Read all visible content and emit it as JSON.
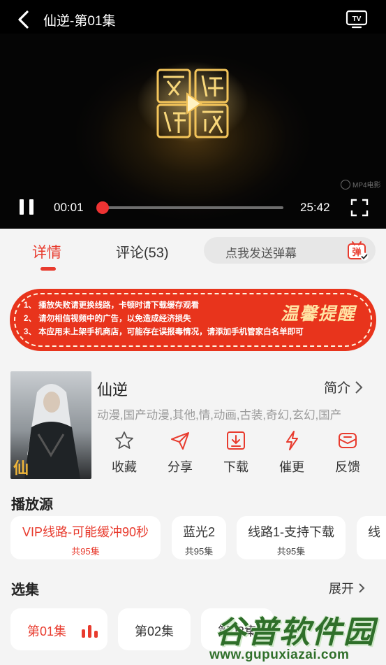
{
  "player": {
    "title": "仙逆-第01集",
    "time_current": "00:01",
    "time_total": "25:42",
    "progress_fraction": 0.003,
    "watermark": "MP4电影",
    "icons": {
      "back": "back-icon",
      "tv": "tv-cast-icon",
      "pause": "pause-icon",
      "fullscreen": "fullscreen-icon"
    }
  },
  "tabs": [
    {
      "label": "详情",
      "active": true
    },
    {
      "label": "评论(53)",
      "active": false
    }
  ],
  "danmu": {
    "placeholder": "点我发送弹幕",
    "icon_label": "弹"
  },
  "notice": {
    "lines": [
      "1、 播放失败请更换线路，卡顿时请下载缓存观看",
      "2、 请勿相信视频中的广告，以免造成经济损失",
      "3、 本应用未上架手机商店，可能存在误报毒情况，请添加手机管家白名单即可"
    ],
    "title": "温馨提醒"
  },
  "show": {
    "name": "仙逆",
    "intro_label": "简介",
    "tags": "动漫,国产动漫,其他,情,动画,古装,奇幻,玄幻,国产"
  },
  "actions": [
    {
      "label": "收藏",
      "icon": "star-icon"
    },
    {
      "label": "分享",
      "icon": "share-icon"
    },
    {
      "label": "下载",
      "icon": "download-icon"
    },
    {
      "label": "催更",
      "icon": "lightning-icon"
    },
    {
      "label": "反馈",
      "icon": "feedback-icon"
    }
  ],
  "sources": {
    "title": "播放源",
    "items": [
      {
        "name": "VIP线路-可能缓冲90秒",
        "count": "共95集",
        "active": true
      },
      {
        "name": "蓝光2",
        "count": "共95集",
        "active": false
      },
      {
        "name": "线路1-支持下载",
        "count": "共95集",
        "active": false
      },
      {
        "name": "线",
        "count": "",
        "active": false
      }
    ]
  },
  "episodes": {
    "title": "选集",
    "expand_label": "展开",
    "items": [
      {
        "label": "第01集",
        "active": true
      },
      {
        "label": "第02集",
        "active": false
      },
      {
        "label": "第03集",
        "active": false
      }
    ]
  },
  "site_watermark": {
    "name": "谷普软件园",
    "url": "www.gupuxiazai.com"
  },
  "colors": {
    "accent": "#e83b2e",
    "banner": "#e8341c",
    "background": "#f4f4f4"
  }
}
